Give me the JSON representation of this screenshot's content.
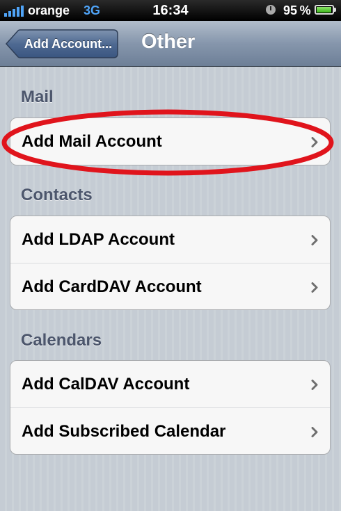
{
  "status_bar": {
    "carrier": "orange",
    "network": "3G",
    "time": "16:34",
    "battery_percent": "95 %",
    "battery_level": 0.95,
    "icons": [
      "signal-bars-icon",
      "clock-icon",
      "battery-icon"
    ]
  },
  "nav_bar": {
    "back_label": "Add Account...",
    "title": "Other"
  },
  "sections": {
    "mail": {
      "header": "Mail",
      "items": [
        {
          "label": "Add Mail Account"
        }
      ]
    },
    "contacts": {
      "header": "Contacts",
      "items": [
        {
          "label": "Add LDAP Account"
        },
        {
          "label": "Add CardDAV Account"
        }
      ]
    },
    "calendars": {
      "header": "Calendars",
      "items": [
        {
          "label": "Add CalDAV Account"
        },
        {
          "label": "Add Subscribed Calendar"
        }
      ]
    }
  },
  "colors": {
    "highlight": "#e0141c",
    "nav_bar": "#8696ac",
    "section_header": "#4c566c",
    "background": "#c5ccd4"
  }
}
